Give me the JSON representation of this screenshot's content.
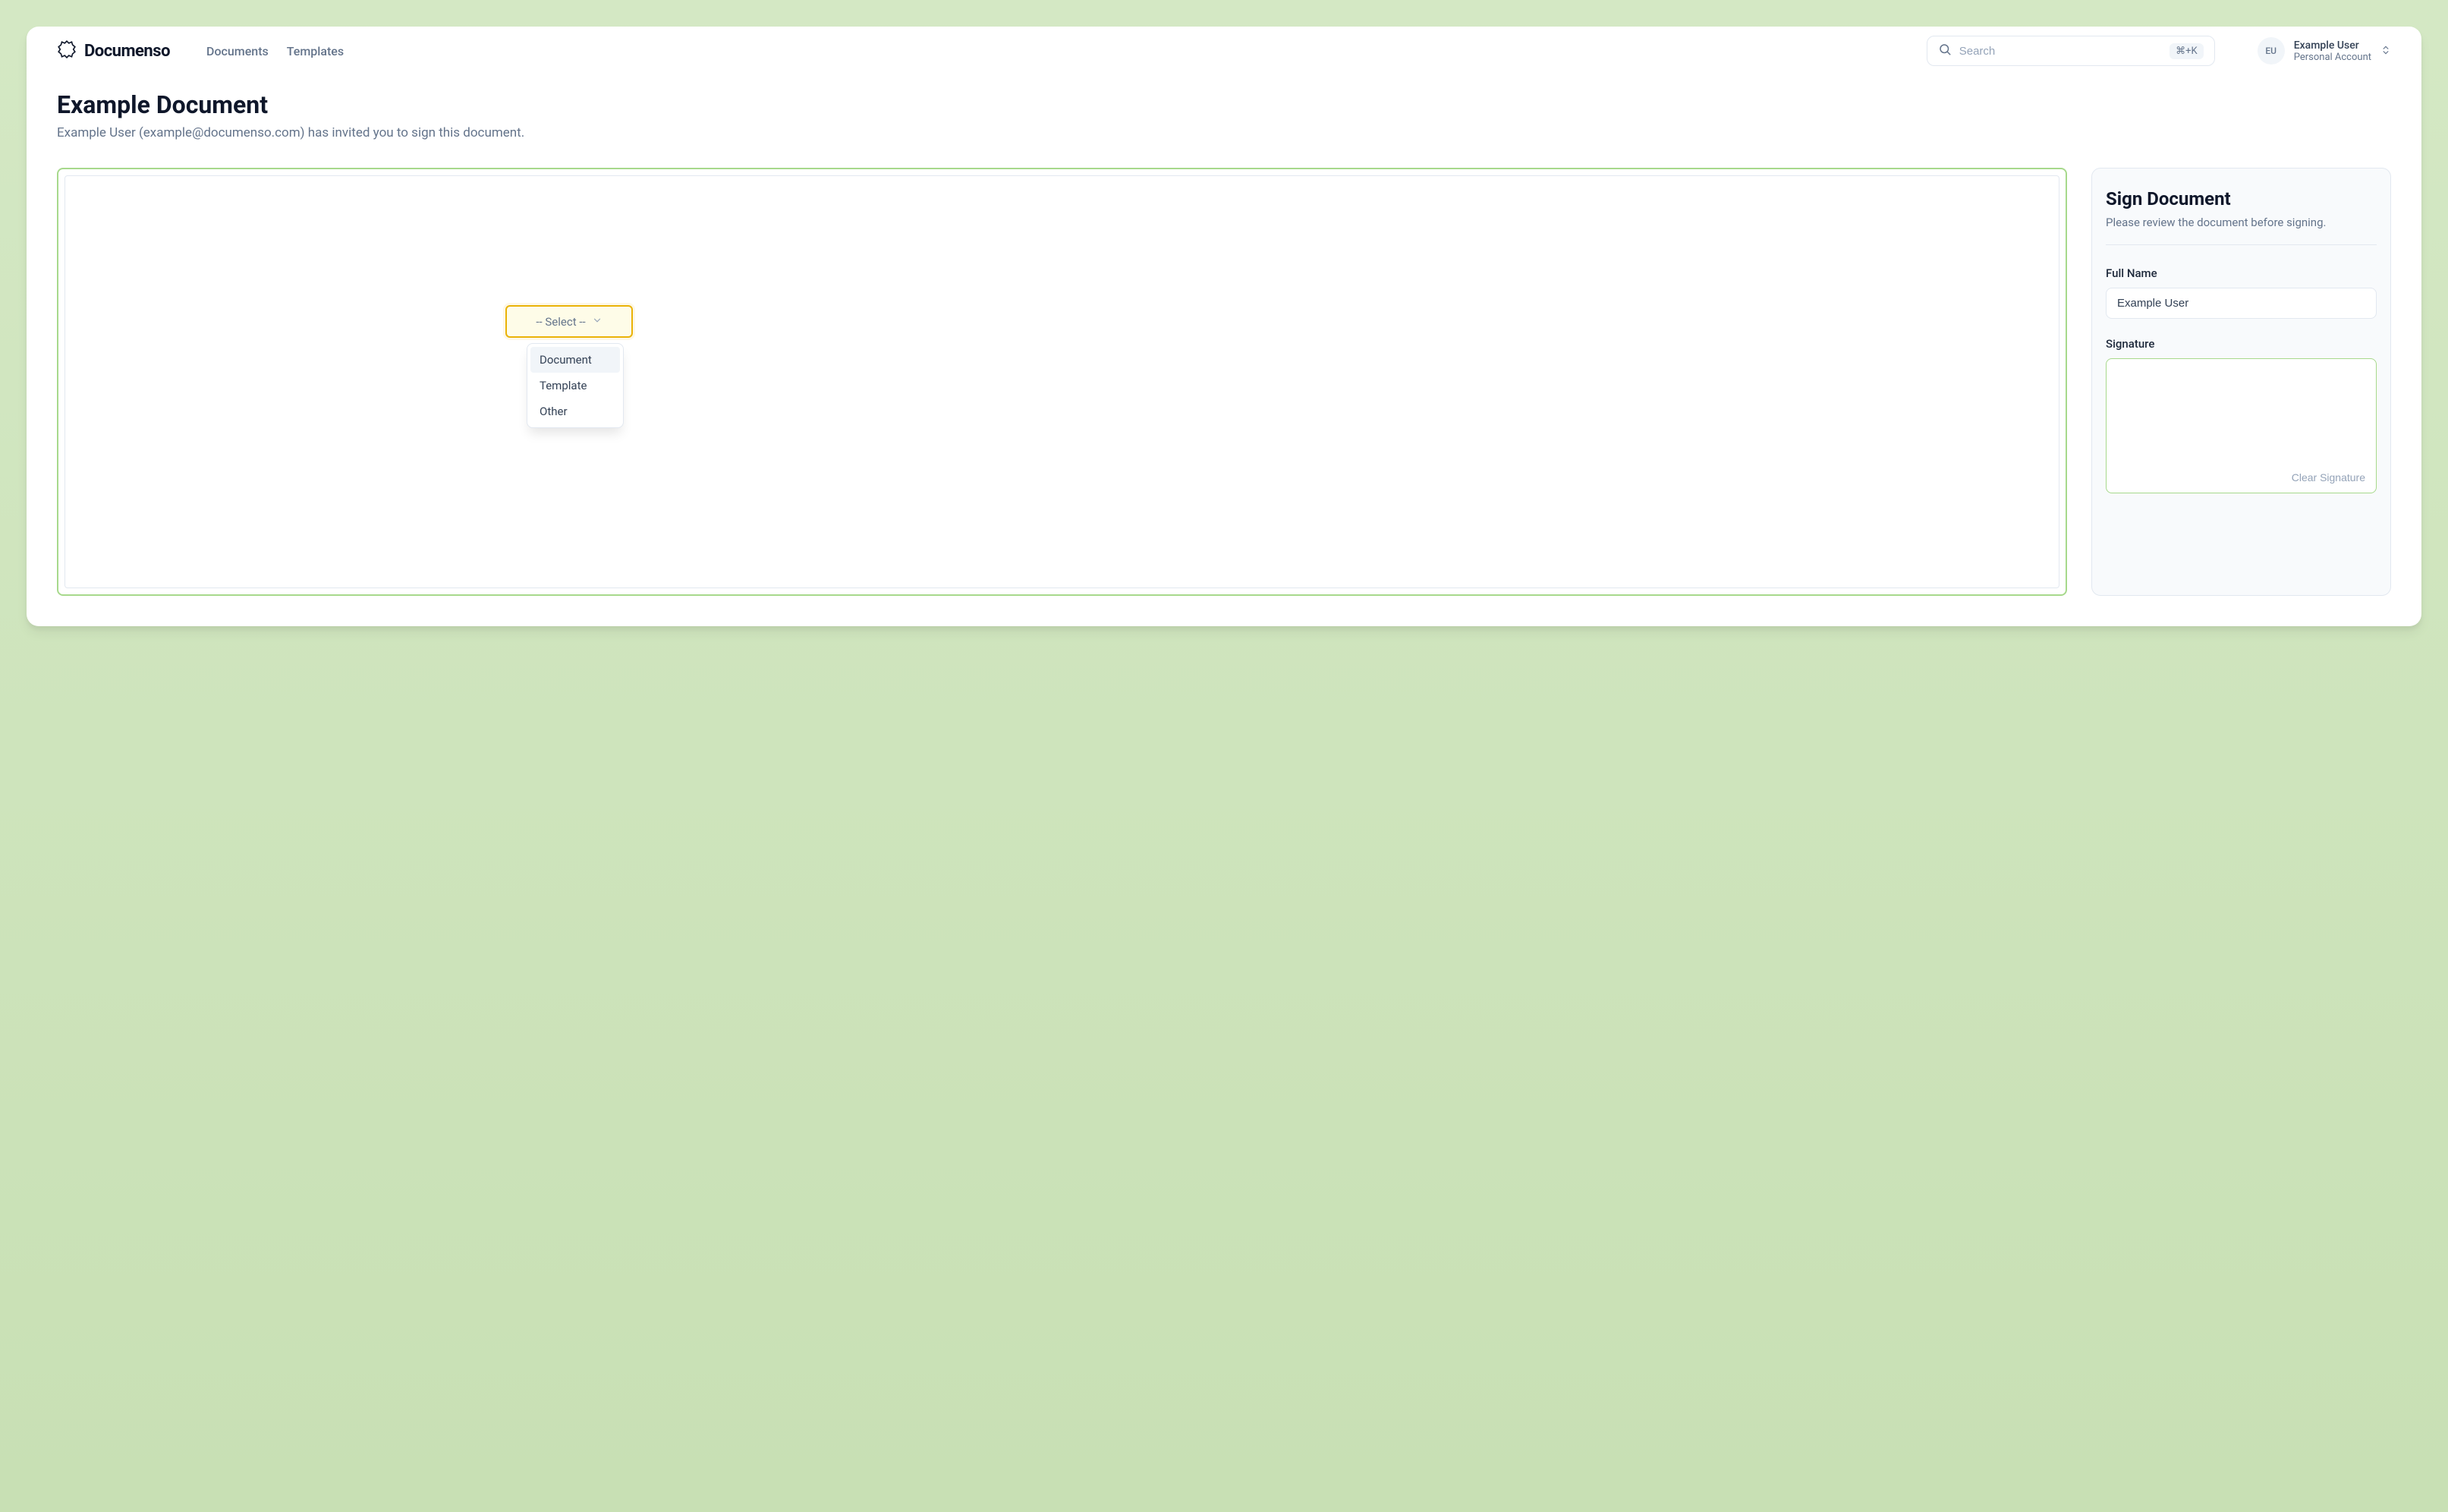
{
  "header": {
    "logo_text": "Documenso",
    "nav": {
      "documents": "Documents",
      "templates": "Templates"
    },
    "search": {
      "placeholder": "Search",
      "shortcut": "⌘+K"
    },
    "user": {
      "avatar_initials": "EU",
      "name": "Example User",
      "subtitle": "Personal Account"
    }
  },
  "page": {
    "title": "Example Document",
    "subtitle": "Example User (example@documenso.com) has invited you to sign this document."
  },
  "document": {
    "select_field": {
      "placeholder": "-- Select --",
      "options": [
        "Document",
        "Template",
        "Other"
      ]
    }
  },
  "sidebar": {
    "title": "Sign Document",
    "subtitle": "Please review the document before signing.",
    "full_name_label": "Full Name",
    "full_name_value": "Example User",
    "signature_label": "Signature",
    "clear_signature": "Clear Signature"
  }
}
